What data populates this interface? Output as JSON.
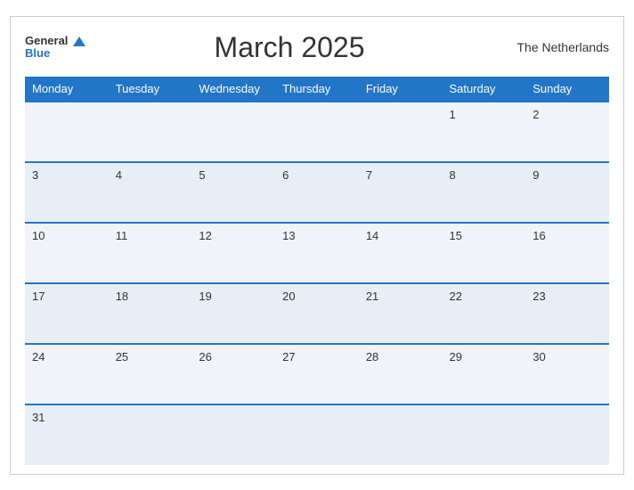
{
  "header": {
    "logo_general": "General",
    "logo_blue": "Blue",
    "title": "March 2025",
    "country": "The Netherlands"
  },
  "weekdays": [
    "Monday",
    "Tuesday",
    "Wednesday",
    "Thursday",
    "Friday",
    "Saturday",
    "Sunday"
  ],
  "weeks": [
    [
      "",
      "",
      "",
      "",
      "",
      "1",
      "2"
    ],
    [
      "3",
      "4",
      "5",
      "6",
      "7",
      "8",
      "9"
    ],
    [
      "10",
      "11",
      "12",
      "13",
      "14",
      "15",
      "16"
    ],
    [
      "17",
      "18",
      "19",
      "20",
      "21",
      "22",
      "23"
    ],
    [
      "24",
      "25",
      "26",
      "27",
      "28",
      "29",
      "30"
    ],
    [
      "31",
      "",
      "",
      "",
      "",
      "",
      ""
    ]
  ]
}
